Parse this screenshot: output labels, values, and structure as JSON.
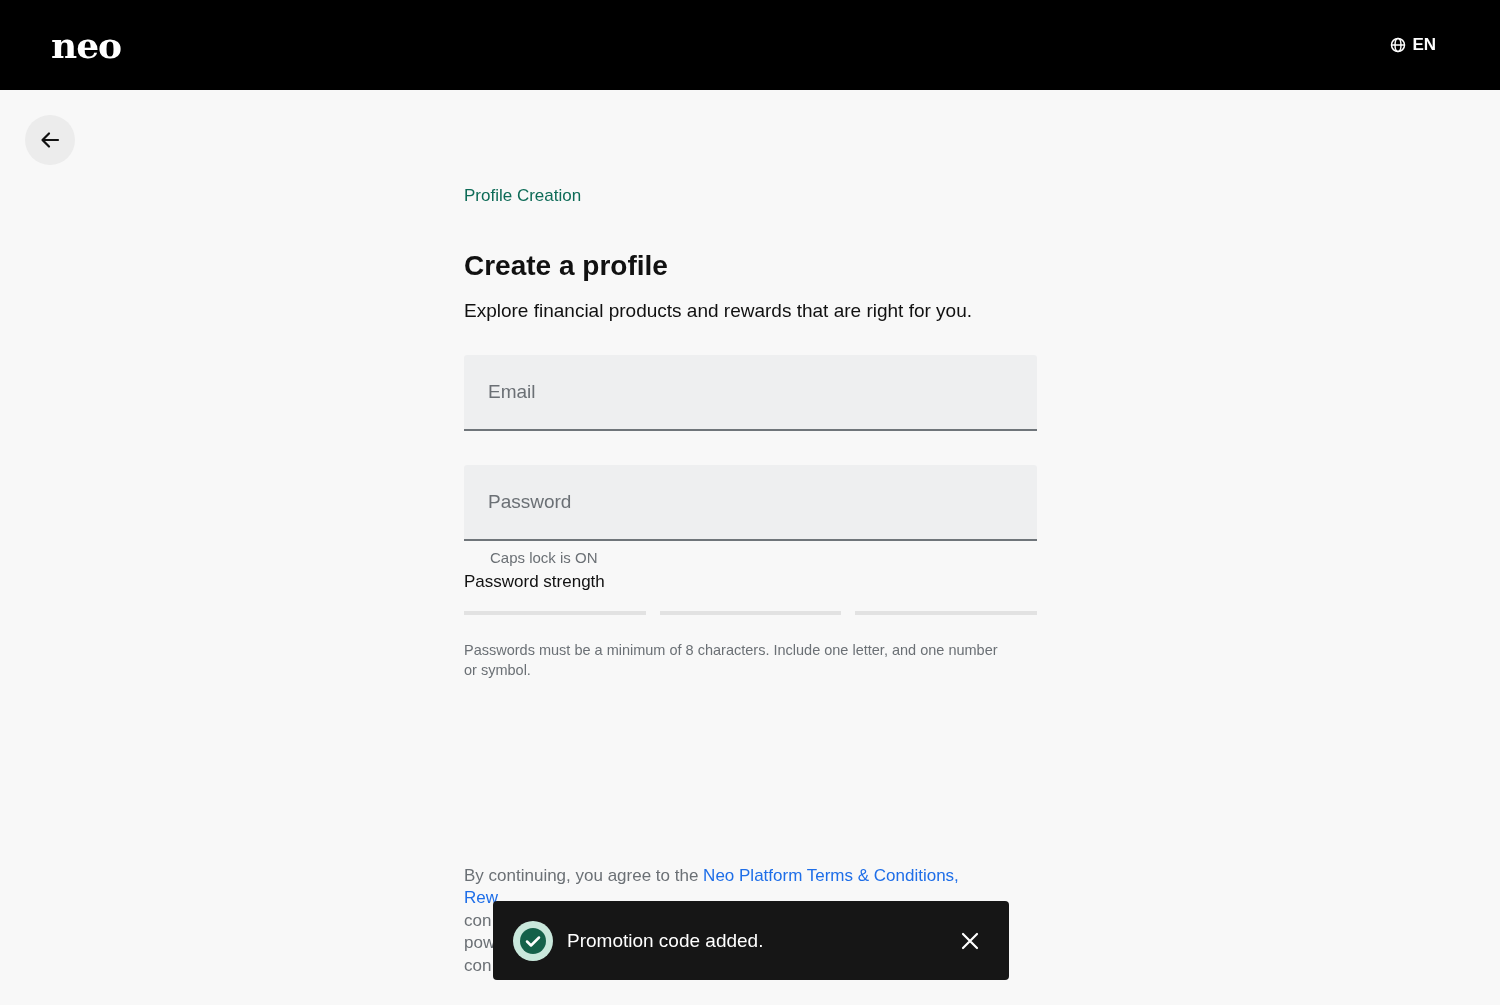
{
  "header": {
    "logo": "neo",
    "language": "EN"
  },
  "breadcrumb": "Profile Creation",
  "title": "Create a profile",
  "subtitle": "Explore financial products and rewards that are right for you.",
  "fields": [
    {
      "placeholder": "Email"
    },
    {
      "placeholder": "Password"
    }
  ],
  "caps_lock_warning": "Caps lock is ON",
  "password_strength": {
    "label": "Password strength",
    "segments": [
      {
        "filled": false
      },
      {
        "filled": false
      },
      {
        "filled": false
      }
    ]
  },
  "password_hint": "Passwords must be a minimum of 8 characters. Include one letter, and one number or symbol.",
  "legal": {
    "text": "By continuing, you agree to the ",
    "link": "Neo Platform Terms & Conditions,",
    "visible_line_starts": [
      {
        "text": "Rew",
        "kind": "link"
      },
      {
        "text": "con",
        "kind": "text"
      },
      {
        "text": "pow",
        "kind": "text"
      },
      {
        "text": "con",
        "kind": "text"
      }
    ]
  },
  "toast": {
    "message": "Promotion code added.",
    "kind": "success"
  }
}
